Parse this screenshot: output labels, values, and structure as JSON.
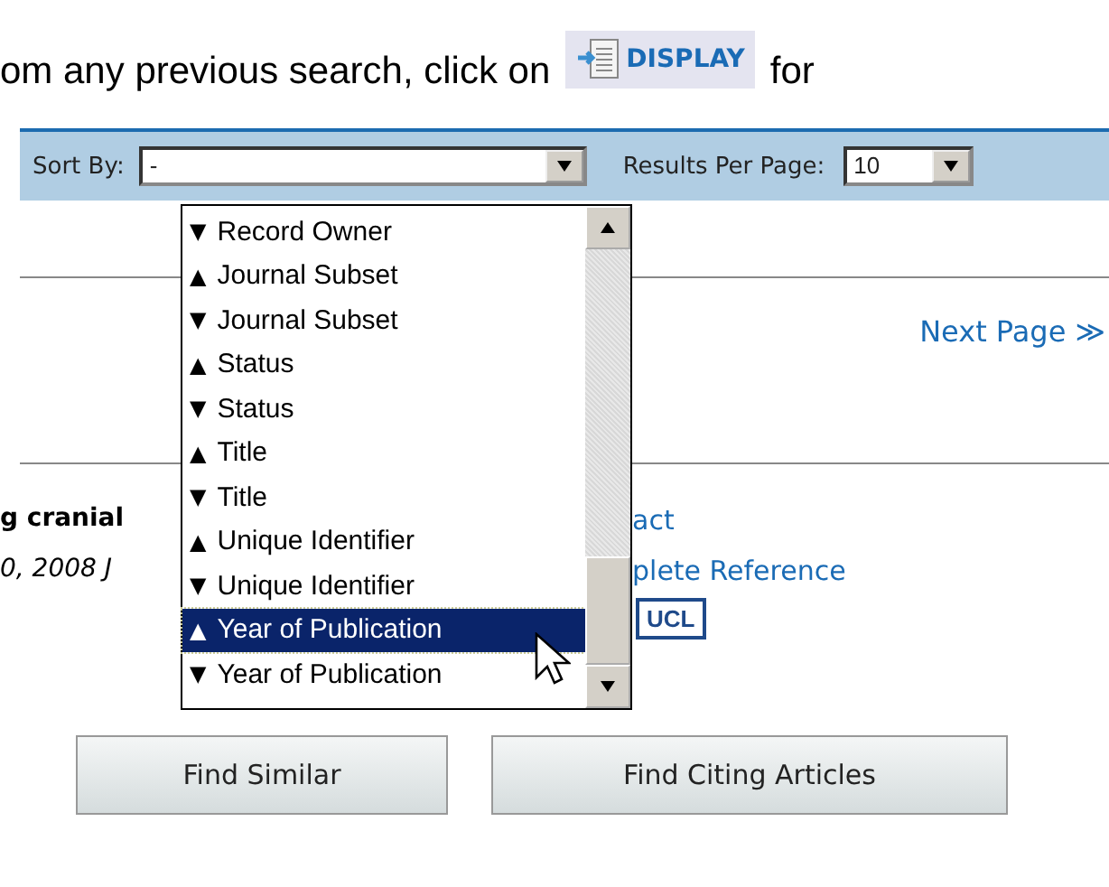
{
  "intro": {
    "before": "om any previous search, click on",
    "button": "DISPLAY",
    "after": "for"
  },
  "toolbar": {
    "sort_label": "Sort By:",
    "sort_value": "-",
    "per_page_label": "Results Per Page:",
    "per_page_value": "10"
  },
  "sort_menu": [
    {
      "marker": "▼",
      "label": "Record Owner",
      "selected": false
    },
    {
      "marker": "▲",
      "label": "Journal Subset",
      "selected": false
    },
    {
      "marker": "▼",
      "label": "Journal Subset",
      "selected": false
    },
    {
      "marker": "▲",
      "label": "Status",
      "selected": false
    },
    {
      "marker": "▼",
      "label": "Status",
      "selected": false
    },
    {
      "marker": "▲",
      "label": "Title",
      "selected": false
    },
    {
      "marker": "▼",
      "label": "Title",
      "selected": false
    },
    {
      "marker": "▲",
      "label": "Unique Identifier",
      "selected": false
    },
    {
      "marker": "▼",
      "label": "Unique Identifier",
      "selected": false
    },
    {
      "marker": "▲",
      "label": "Year of Publication",
      "selected": true
    },
    {
      "marker": "▼",
      "label": "Year of Publication",
      "selected": false
    }
  ],
  "next_page": "Next Page ≫",
  "result": {
    "title": "g cranial",
    "source": "0, 2008 J",
    "links": [
      "act",
      "plete Reference"
    ],
    "badge": "UCL"
  },
  "buttons": [
    "Find Similar",
    "Find Citing Articles"
  ]
}
